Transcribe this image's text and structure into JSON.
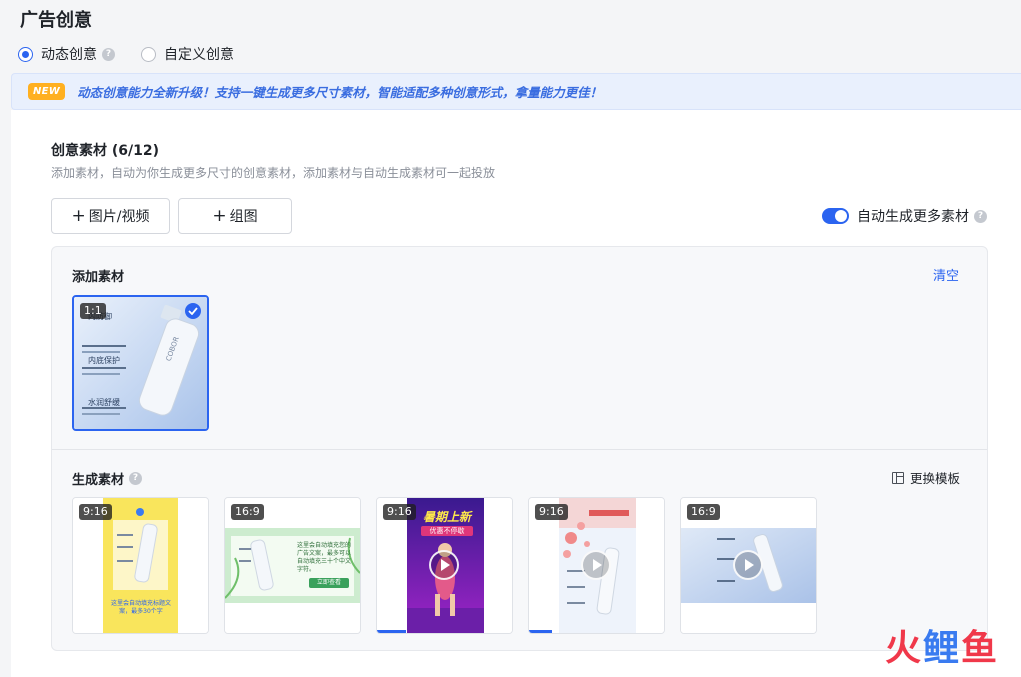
{
  "page": {
    "title": "广告创意"
  },
  "creative_type": {
    "options": [
      {
        "label": "动态创意",
        "selected": true
      },
      {
        "label": "自定义创意",
        "selected": false
      }
    ]
  },
  "banner": {
    "badge": "NEW",
    "text": "动态创意能力全新升级！支持一键生成更多尺寸素材，智能适配多种创意形式，拿量能力更佳！"
  },
  "materials": {
    "title": "创意素材 (6/12)",
    "subtitle": "添加素材，自动为你生成更多尺寸的创意素材，添加素材与自动生成素材可一起投放",
    "add_image_video_label": "图片/视频",
    "add_group_label": "组图",
    "auto_generate_label": "自动生成更多素材",
    "auto_generate_on": true
  },
  "added_assets": {
    "label": "添加素材",
    "clear_label": "清空",
    "items": [
      {
        "ratio": "1:1",
        "selected": true,
        "lines": [
          "内防御",
          "内底保护",
          "水润舒缓"
        ],
        "brand": "COBOR"
      }
    ]
  },
  "generated_assets": {
    "label": "生成素材",
    "template_label": "更换模板",
    "items": [
      {
        "ratio": "9:16",
        "type": "image",
        "caption": "这里会自动填充标题文案，最多30个字"
      },
      {
        "ratio": "16:9",
        "type": "image",
        "caption": "这里会自动填充您的广告文案，最多可以自动填充三十个中文字符。",
        "button": "立即查看"
      },
      {
        "ratio": "9:16",
        "type": "video",
        "headline": "暑期上新",
        "subline": "优惠不停歇",
        "progress": 0.25
      },
      {
        "ratio": "9:16",
        "type": "video",
        "progress": 0.3
      },
      {
        "ratio": "16:9",
        "type": "video"
      }
    ]
  },
  "watermark": {
    "chars": [
      "火",
      "鲤",
      "鱼"
    ],
    "colors": [
      "#f0384a",
      "#3a7bf0",
      "#f0384a"
    ]
  }
}
